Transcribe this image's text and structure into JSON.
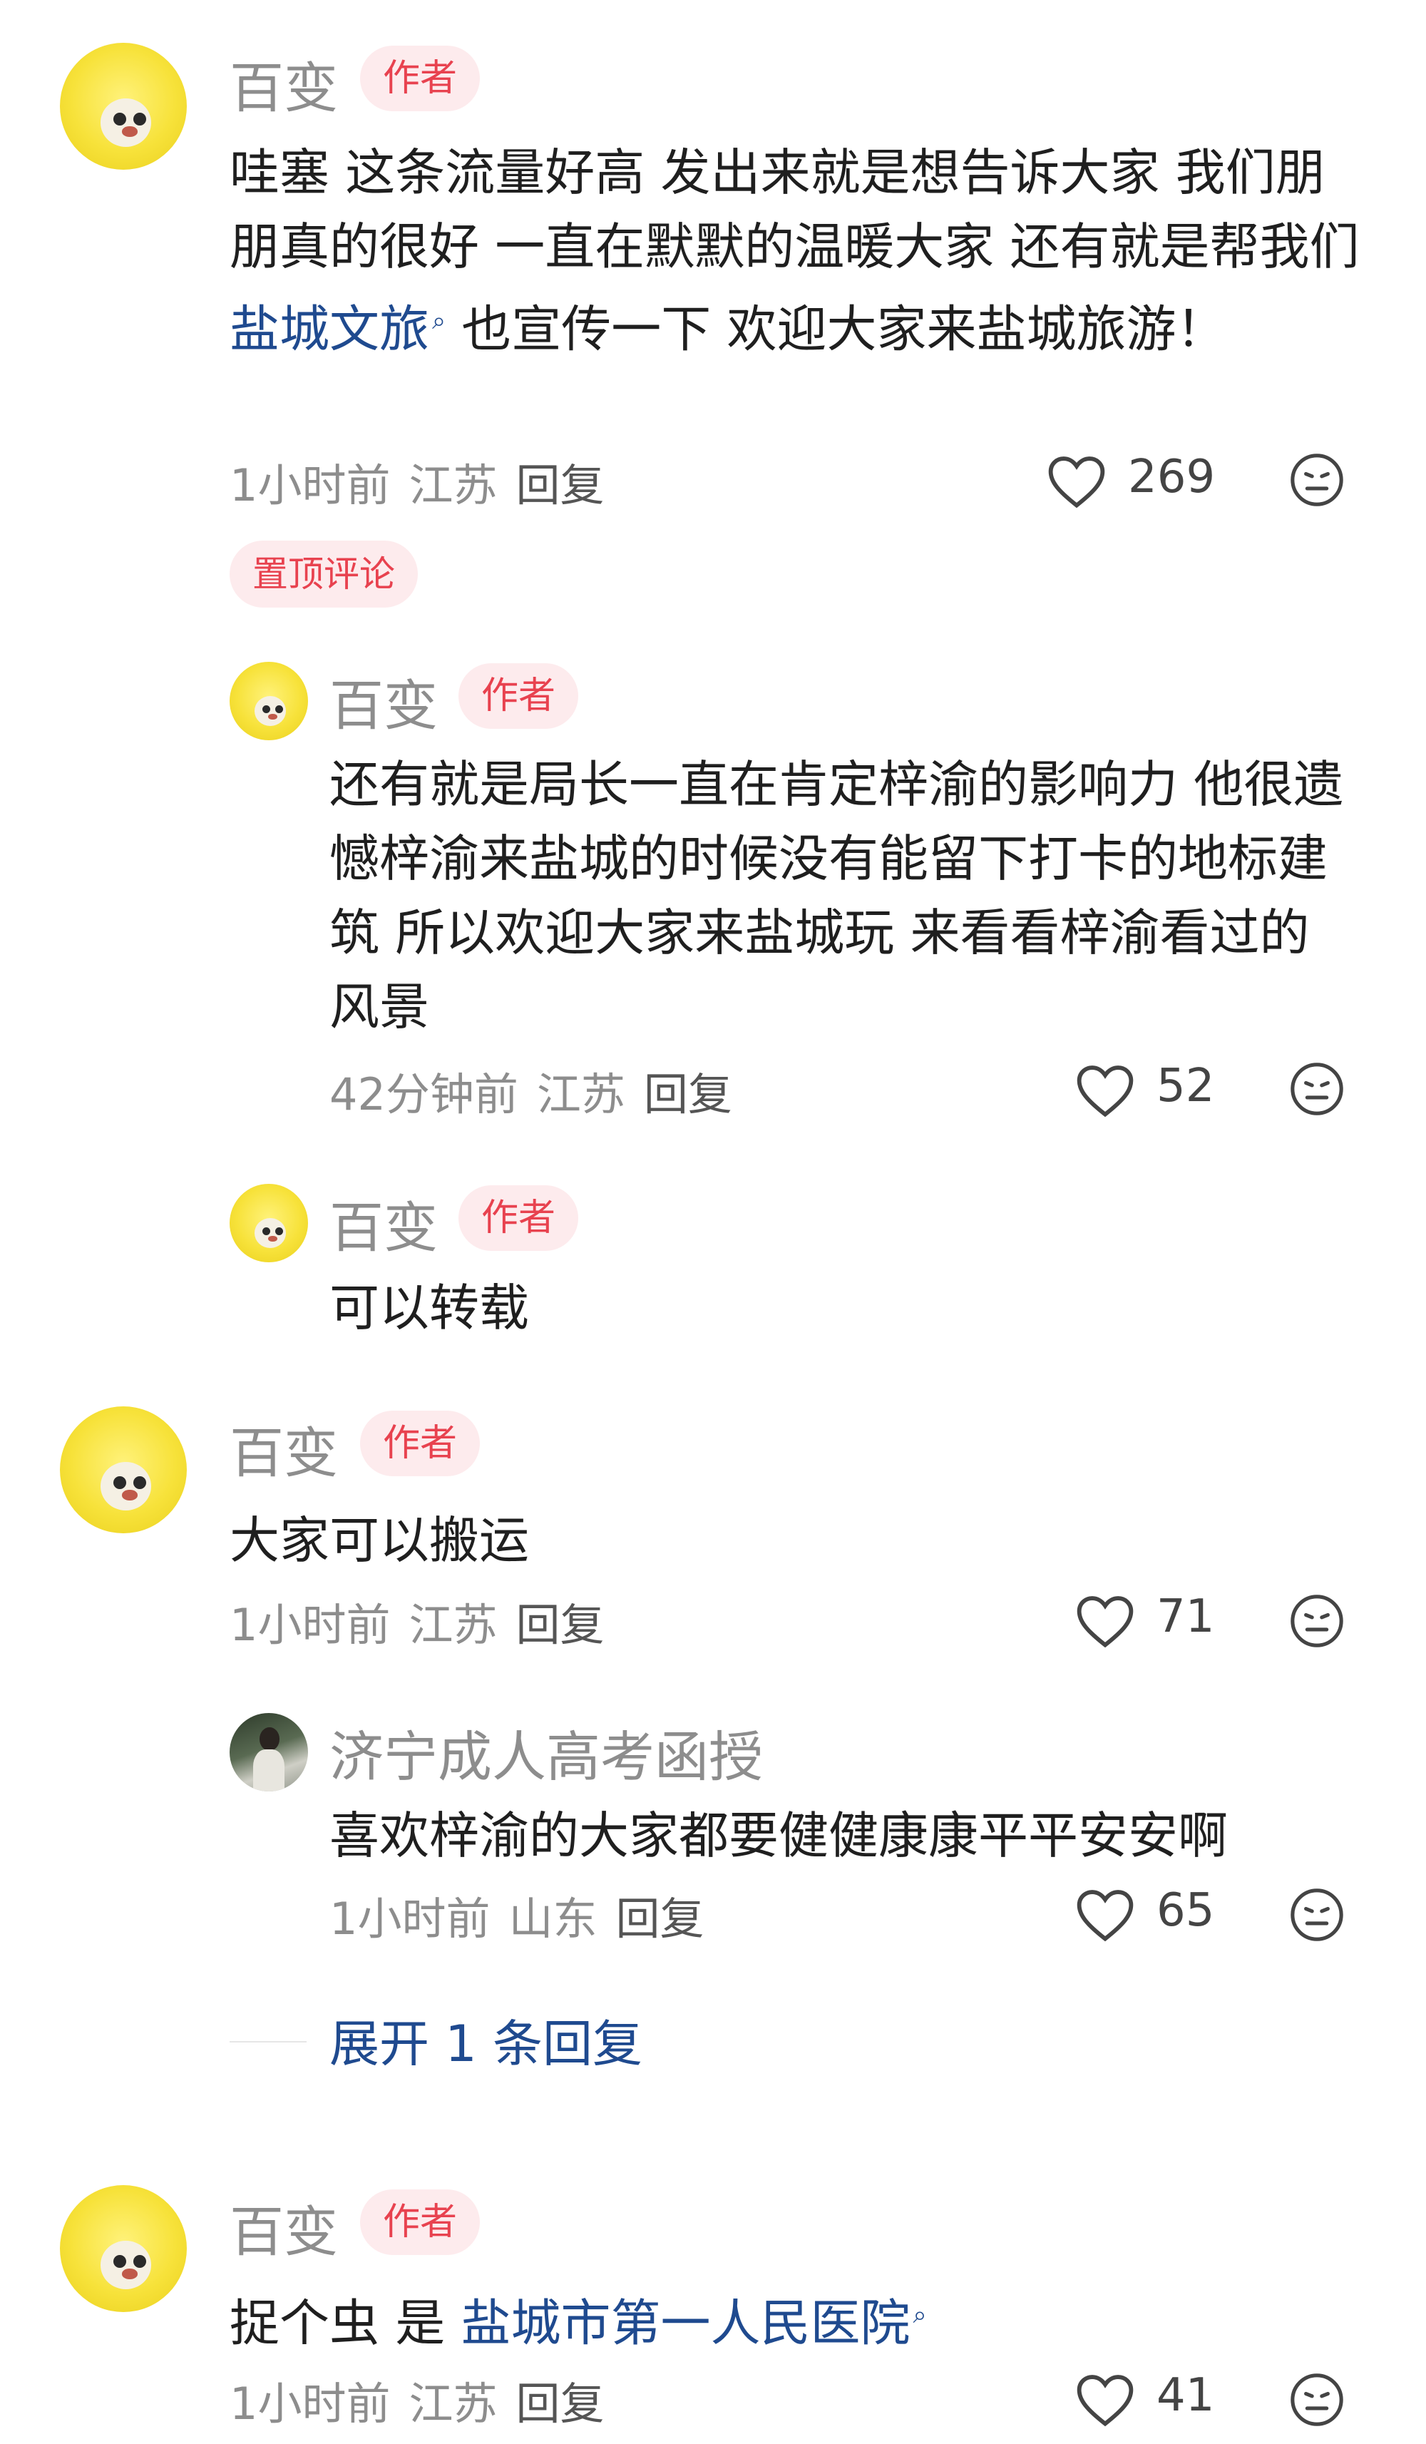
{
  "comments": [
    {
      "name": "百变",
      "badge": "作者",
      "text_before": "哇塞 这条流量好高 发出来就是想告诉大家 我们朋朋真的很好 一直在默默的温暖大家 还有就是帮我们 ",
      "link": "盐城文旅",
      "text_after": " 也宣传一下 欢迎大家来盐城旅游！",
      "time": "1小时前",
      "location": "江苏",
      "reply": "回复",
      "likes": "269",
      "pin_label": "置顶评论",
      "replies": [
        {
          "name": "百变",
          "badge": "作者",
          "text": "还有就是局长一直在肯定梓渝的影响力 他很遗憾梓渝来盐城的时候没有能留下打卡的地标建筑 所以欢迎大家来盐城玩 来看看梓渝看过的风景",
          "time": "42分钟前",
          "location": "江苏",
          "reply": "回复",
          "likes": "52"
        },
        {
          "name": "百变",
          "badge": "作者",
          "text": "可以转载"
        }
      ]
    },
    {
      "name": "百变",
      "badge": "作者",
      "text": "大家可以搬运",
      "time": "1小时前",
      "location": "江苏",
      "reply": "回复",
      "likes": "71",
      "replies": [
        {
          "name": "济宁成人高考函授",
          "text": "喜欢梓渝的大家都要健健康康平平安安啊",
          "time": "1小时前",
          "location": "山东",
          "reply": "回复",
          "likes": "65"
        }
      ],
      "expand": "展开 1 条回复"
    },
    {
      "name": "百变",
      "badge": "作者",
      "text_before": "捉个虫 是 ",
      "link": "盐城市第一人民医院",
      "time": "1小时前",
      "location": "江苏",
      "reply": "回复",
      "likes": "41"
    }
  ],
  "icons": {
    "like": "heart-outline-icon",
    "dislike": "neutral-face-icon",
    "search_mark": "search-mark-icon"
  },
  "colors": {
    "badge_text": "#e8424f",
    "badge_bg": "#fdebed",
    "link": "#1f4a8f",
    "meta": "#8d8d8d"
  }
}
